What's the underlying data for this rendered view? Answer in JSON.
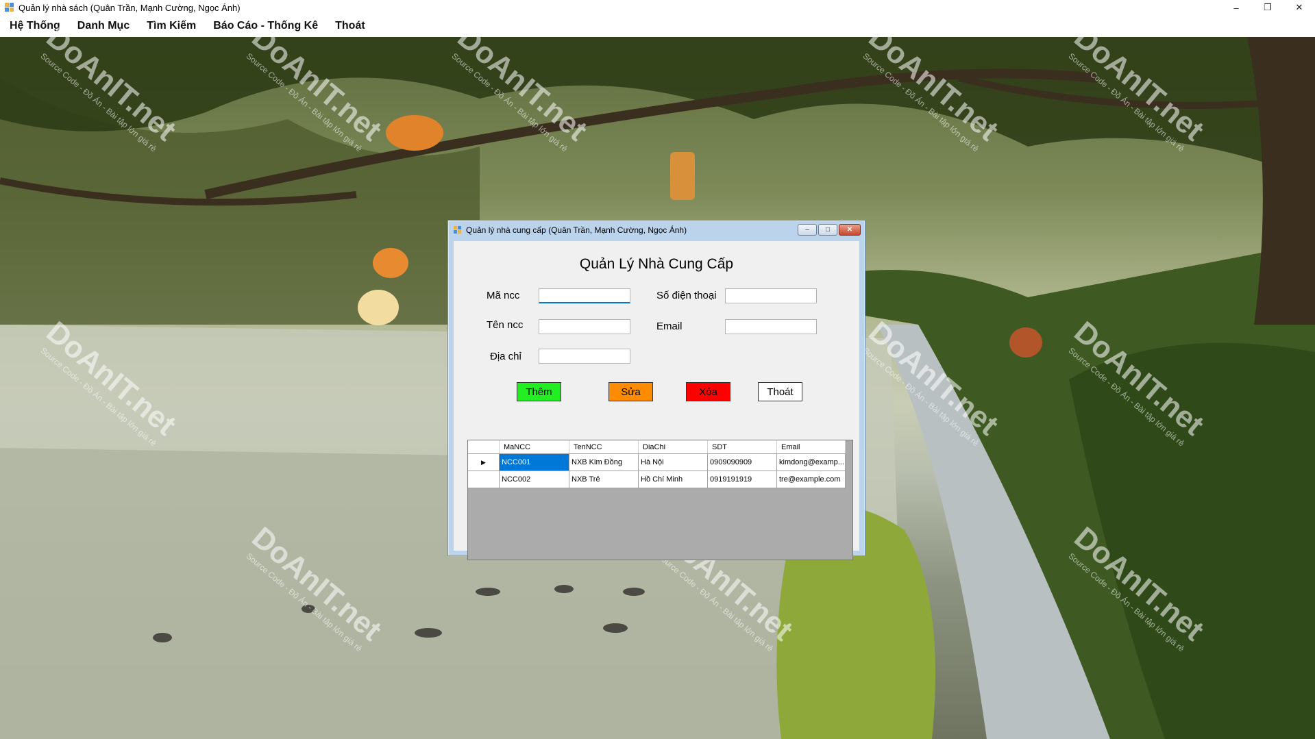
{
  "window": {
    "title": "Quản lý nhà sách (Quân Trần, Mạnh Cường, Ngọc Ánh)",
    "controls": [
      "minimize-icon",
      "maximize-icon",
      "close-icon"
    ]
  },
  "menu": {
    "items": [
      "Hệ Thống",
      "Danh Mục",
      "Tìm Kiếm",
      "Báo Cáo - Thống Kê",
      "Thoát"
    ]
  },
  "dialog": {
    "title": "Quản lý nhà cung cấp (Quân Trần, Mạnh Cường, Ngọc Ánh)",
    "heading": "Quản Lý Nhà Cung Cấp",
    "fields": {
      "ma_ncc": {
        "label": "Mã ncc",
        "value": ""
      },
      "ten_ncc": {
        "label": "Tên ncc",
        "value": ""
      },
      "dia_chi": {
        "label": "Địa chỉ",
        "value": ""
      },
      "so_dien_thoai": {
        "label": "Số điện thoại",
        "value": ""
      },
      "email": {
        "label": "Email",
        "value": ""
      }
    },
    "buttons": {
      "them": "Thêm",
      "sua": "Sửa",
      "xoa": "Xóa",
      "thoat": "Thoát"
    },
    "grid": {
      "columns": [
        "MaNCC",
        "TenNCC",
        "DiaChi",
        "SDT",
        "Email"
      ],
      "rows": [
        [
          "NCC001",
          "NXB Kim Đồng",
          "Hà Nội",
          "0909090909",
          "kimdong@examp..."
        ],
        [
          "NCC002",
          "NXB Trẻ",
          "Hồ Chí Minh",
          "0919191919",
          "tre@example.com"
        ]
      ]
    }
  },
  "colors": {
    "them": "#22ee22",
    "sua": "#ff8c00",
    "xoa": "#ff0000",
    "selection": "#0078d7"
  },
  "watermark": {
    "brand": "DoAnIT.net",
    "tagline": "Source Code - Đồ Án - Bài tập lớn giá rẻ"
  }
}
